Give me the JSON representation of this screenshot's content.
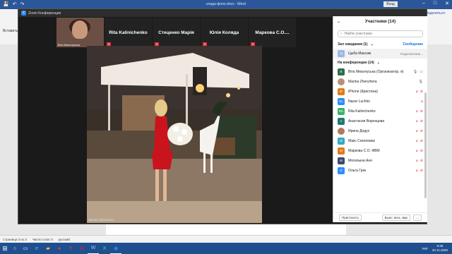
{
  "word": {
    "doc_title": "клада флоо.docx  -  Word",
    "sign_in": "Вход",
    "share_label": "Поделиться",
    "paste_label": "Вставить",
    "status": [
      "Страница 3 из 3",
      "Число слов: 0",
      "русский"
    ]
  },
  "zoom": {
    "title": "Zoom Конференция",
    "thumbnails": [
      {
        "name": "Віта Мисилуська",
        "type": "video"
      },
      {
        "name": "Rita Kalinichenko",
        "type": "name"
      },
      {
        "name": "Стеценко Марія",
        "type": "name"
      },
      {
        "name": "Юлія Коляда",
        "type": "name"
      },
      {
        "name": "Маркова С.О....",
        "type": "name"
      }
    ],
    "active_speaker": "Marina Zhenzhera"
  },
  "panel": {
    "title": "Участники (14)",
    "search_placeholder": "Найти участника",
    "waiting_label": "Зал ожидания (1)",
    "admit_label": "Сообщение",
    "waiting_person": {
      "name": "Цыба Максим",
      "action": "Подключение..."
    },
    "in_meeting_label": "На конференции (14)",
    "participants": [
      {
        "initials": "В",
        "name": "Віта Мисилуська (Организатор, я)",
        "color": "#2e6e4a",
        "mic": "on",
        "cam": "on"
      },
      {
        "initials": "",
        "name": "Marina Zhenzhera",
        "color": "#b88f78",
        "photo": true,
        "mic": "on",
        "cam": ""
      },
      {
        "initials": "iP",
        "name": "iPhone (Кристина)",
        "color": "#e07b1a",
        "mic": "muted",
        "cam": "off"
      },
      {
        "initials": "NL",
        "name": "Nazar Luchko",
        "color": "#2d8cff",
        "mic": "muted",
        "cam": ""
      },
      {
        "initials": "RK",
        "name": "Rita Kalinichenko",
        "color": "#39b26a",
        "mic": "muted",
        "cam": "off"
      },
      {
        "initials": "А",
        "name": "Анастасия Воронцова",
        "color": "#1d7a6f",
        "mic": "muted",
        "cam": "off"
      },
      {
        "initials": "",
        "name": "Ирина Додух",
        "color": "#b07a5e",
        "photo": true,
        "mic": "muted",
        "cam": "off"
      },
      {
        "initials": "М",
        "name": "Макс Соколовак",
        "color": "#35a8c7",
        "mic": "muted",
        "cam": "off"
      },
      {
        "initials": "М",
        "name": "Маркова С.О. ФВМ",
        "color": "#e07b1a",
        "mic": "muted",
        "cam": "off"
      },
      {
        "initials": "М",
        "name": "Могилына Аня",
        "color": "#3b4a6b",
        "mic": "muted",
        "cam": "off"
      },
      {
        "initials": "О",
        "name": "Ольга Грек",
        "color": "#2d8cff",
        "mic": "muted",
        "cam": "off"
      }
    ],
    "footer": [
      "Пригласить",
      "Выкл. весь звук",
      "..."
    ]
  },
  "taskbar": {
    "lang": "УКР",
    "time": "9:48",
    "date": "10.11.2020"
  }
}
